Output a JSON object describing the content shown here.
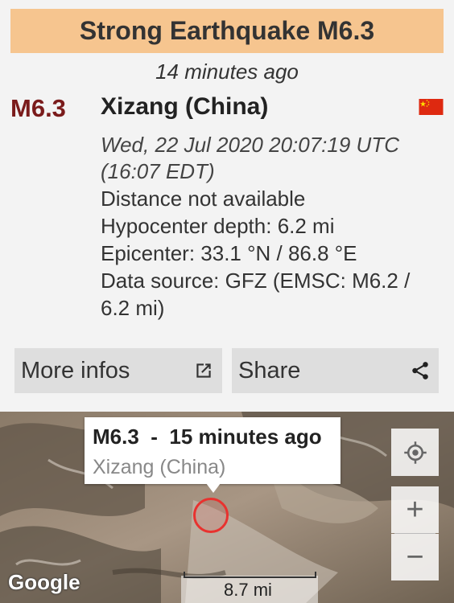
{
  "header": {
    "title": "Strong Earthquake M6.3"
  },
  "event": {
    "time_ago": "14 minutes ago",
    "magnitude": "M6.3",
    "region": "Xizang (China)",
    "country_flag": "china-flag",
    "datetime_utc": "Wed, 22 Jul 2020 20:07:19 UTC",
    "datetime_local": "(16:07 EDT)",
    "distance": "Distance not available",
    "depth": "Hypocenter depth: 6.2 mi",
    "epicenter": "Epicenter: 33.1 °N / 86.8 °E",
    "source_line1": "Data source: GFZ (EMSC: M6.2 /",
    "source_line2": "6.2 mi)"
  },
  "actions": {
    "more_infos_label": "More infos",
    "more_infos_icon": "external-link-icon",
    "share_label": "Share",
    "share_icon": "share-icon"
  },
  "map": {
    "popup_title": "M6.3  -  15 minutes ago",
    "popup_subtitle": "Xizang (China)",
    "provider_logo": "Google",
    "scale_label": "8.7 mi",
    "zoom_in_label": "+",
    "zoom_out_label": "−",
    "marker_color": "#e8322f"
  },
  "colors": {
    "title_background": "#f6c58f",
    "magnitude": "#7a1b1b",
    "button_background": "#dedede"
  }
}
